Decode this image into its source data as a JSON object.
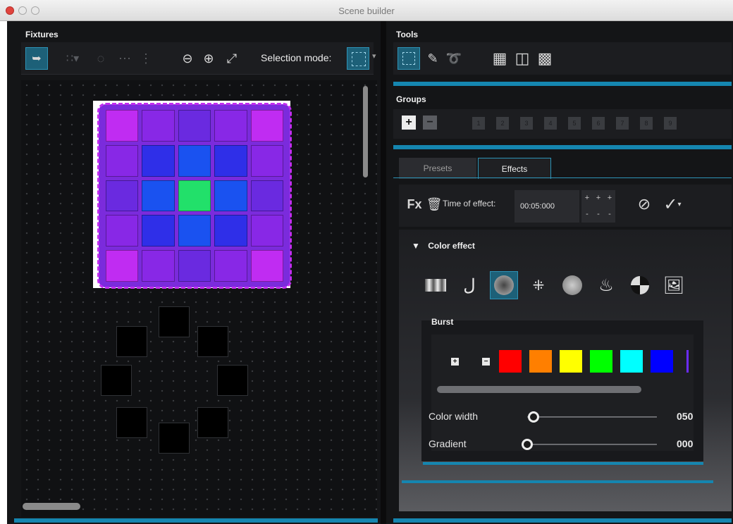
{
  "window": {
    "title": "Scene builder"
  },
  "fixtures": {
    "header": "Fixtures",
    "selection_mode_label": "Selection mode:",
    "tool_icons": [
      "pointer-icon",
      "grid-dots-icon",
      "circle-dots-icon",
      "horizontal-dots-icon",
      "vertical-dots-icon",
      "zoom-out-icon",
      "zoom-in-icon",
      "fit-screen-icon"
    ],
    "matrix_colors": [
      [
        "#c02cf2",
        "#8828e6",
        "#6a2ae0",
        "#8828e6",
        "#c02cf2"
      ],
      [
        "#8828e6",
        "#2f2fe8",
        "#1a52f0",
        "#2f2fe8",
        "#8828e6"
      ],
      [
        "#6a2ae0",
        "#1a52f0",
        "#22e06a",
        "#1a52f0",
        "#6a2ae0"
      ],
      [
        "#8828e6",
        "#2f2fe8",
        "#1a52f0",
        "#2f2fe8",
        "#8828e6"
      ],
      [
        "#c02cf2",
        "#8828e6",
        "#6a2ae0",
        "#8828e6",
        "#c02cf2"
      ]
    ]
  },
  "tools": {
    "header": "Tools",
    "icons": [
      "selection-icon",
      "pencil-icon",
      "fill-icon",
      "layout-2x2-icon",
      "layout-hollow-icon",
      "layout-mixed-icon"
    ]
  },
  "groups": {
    "header": "Groups",
    "numbers": [
      "1",
      "2",
      "3",
      "4",
      "5",
      "6",
      "7",
      "8",
      "9"
    ]
  },
  "tabs": {
    "presets": "Presets",
    "effects": "Effects"
  },
  "effect": {
    "time_label": "Time of effect:",
    "time_value": "00:05:000",
    "stepper": [
      "+",
      "+",
      "+",
      "-",
      "-",
      "-"
    ],
    "section_title": "Color effect",
    "effect_icons": [
      "gradient-bars-icon",
      "spiral-icon",
      "burst-icon",
      "dots-icon",
      "sphere-icon",
      "fire-icon",
      "quarter-circle-icon",
      "image-icon"
    ],
    "burst": {
      "title": "Burst",
      "add": "+",
      "remove": "−",
      "colors": [
        "#ff0000",
        "#ff7f00",
        "#ffff00",
        "#00ff00",
        "#00ffff",
        "#0000ff"
      ]
    },
    "color_width": {
      "label": "Color width",
      "value": "050",
      "fraction": 0.05
    },
    "gradient": {
      "label": "Gradient",
      "value": "000",
      "fraction": 0.0
    }
  },
  "accent": "#1586b0"
}
